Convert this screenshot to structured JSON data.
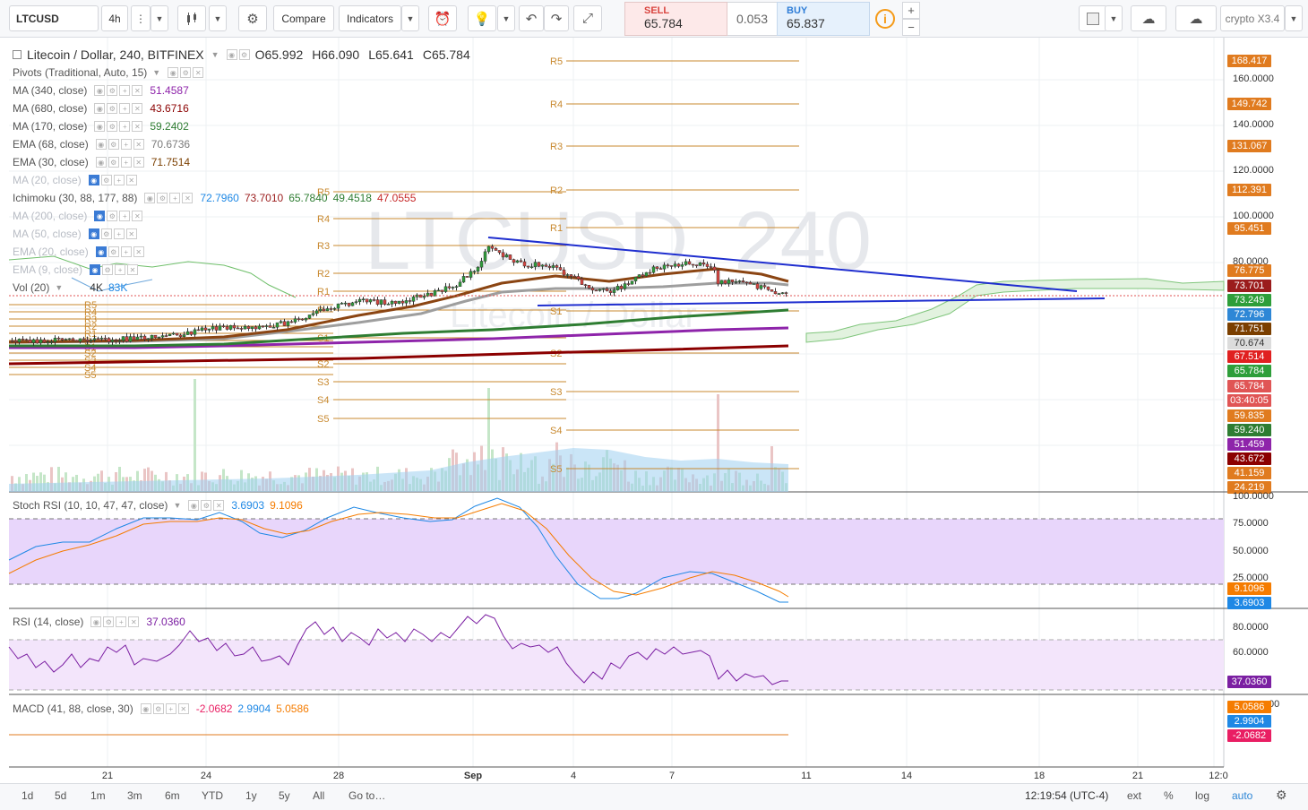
{
  "toolbar": {
    "symbol": "LTCUSD",
    "interval": "4h",
    "compare_label": "Compare",
    "indicators_label": "Indicators",
    "sell_label": "SELL",
    "sell_price": "65.784",
    "spread": "0.053",
    "buy_label": "BUY",
    "buy_price": "65.837",
    "layout_name": "crypto X3.4",
    "icons": [
      "bars-dropdown-icon",
      "candles-icon",
      "gear-icon",
      "alert-icon",
      "lightbulb-icon",
      "undo-icon",
      "redo-icon",
      "fullscreen-icon",
      "info-icon",
      "rectangle-icon",
      "cloud-icon",
      "cloud-upload-icon"
    ]
  },
  "legend": {
    "main": {
      "title": "Litecoin / Dollar, 240, BITFINEX",
      "o": "O65.992",
      "h": "H66.090",
      "l": "L65.641",
      "c": "C65.784"
    },
    "pivots": "Pivots (Traditional, Auto, 15)",
    "ma340": {
      "name": "MA (340, close)",
      "value": "51.4587",
      "color": "#8e24aa"
    },
    "ma680": {
      "name": "MA (680, close)",
      "value": "43.6716",
      "color": "#8b0000"
    },
    "ma170": {
      "name": "MA (170, close)",
      "value": "59.2402",
      "color": "#2e7d32"
    },
    "ema68": {
      "name": "EMA (68, close)",
      "value": "70.6736",
      "color": "#9e9e9e"
    },
    "ema30": {
      "name": "EMA (30, close)",
      "value": "71.7514",
      "color": "#7b3f00"
    },
    "ma20": "MA (20, close)",
    "ichimoku": {
      "name": "Ichimoku (30, 88, 177, 88)",
      "v1": "72.7960",
      "v2": "73.7010",
      "v3": "65.7840",
      "v4": "49.4518",
      "v5": "47.0555"
    },
    "ma200": "MA (200, close)",
    "ma50": "MA (50, close)",
    "ema20": "EMA (20, close)",
    "ema9": "EMA (9, close)",
    "vol": {
      "name": "Vol (20)",
      "v1": "4K",
      "v2": "83K"
    },
    "stoch": {
      "name": "Stoch RSI (10, 10, 47, 47, close)",
      "k": "3.6903",
      "d": "9.1096"
    },
    "rsi": {
      "name": "RSI (14, close)",
      "value": "37.0360"
    },
    "macd": {
      "name": "MACD (41, 88, close, 30)",
      "v1": "-2.0682",
      "v2": "2.9904",
      "v3": "5.0586"
    }
  },
  "watermark": {
    "symbol": "LTCUSD, 240",
    "name": "Litecoin / Dollar"
  },
  "price_scale": {
    "ticks": [
      "160.0000",
      "140.0000",
      "120.0000",
      "100.0000",
      "80.0000"
    ],
    "labels": [
      {
        "text": "168.417",
        "color": "#e07b1f"
      },
      {
        "text": "149.742",
        "color": "#e07b1f"
      },
      {
        "text": "131.067",
        "color": "#e07b1f"
      },
      {
        "text": "112.391",
        "color": "#e07b1f"
      },
      {
        "text": "95.451",
        "color": "#e07b1f"
      },
      {
        "text": "76.775",
        "color": "#e07b1f"
      },
      {
        "text": "73.701",
        "color": "#9b1c1c"
      },
      {
        "text": "73.249",
        "color": "#2e9e3a"
      },
      {
        "text": "72.796",
        "color": "#2e87d6"
      },
      {
        "text": "71.751",
        "color": "#7b3f00"
      },
      {
        "text": "70.674",
        "color": "#9e9e9e"
      },
      {
        "text": "67.514",
        "color": "#e02020"
      },
      {
        "text": "65.784",
        "color": "#2e9e3a"
      },
      {
        "text": "65.784",
        "color": "#e05555"
      },
      {
        "text": "03:40:05",
        "color": "#e05555"
      },
      {
        "text": "59.835",
        "color": "#e07b1f"
      },
      {
        "text": "59.240",
        "color": "#2e7d32"
      },
      {
        "text": "51.459",
        "color": "#8e24aa"
      },
      {
        "text": "43.672",
        "color": "#8b0000"
      },
      {
        "text": "41.159",
        "color": "#e07b1f"
      },
      {
        "text": "24.219",
        "color": "#e07b1f"
      }
    ],
    "stoch_ticks": [
      "100.0000",
      "75.0000",
      "50.0000",
      "25.0000"
    ],
    "stoch_labels": [
      {
        "text": "9.1096",
        "color": "#f57c00"
      },
      {
        "text": "3.6903",
        "color": "#1e88e5"
      }
    ],
    "rsi_ticks": [
      "80.0000",
      "60.0000"
    ],
    "rsi_label": {
      "text": "37.0360",
      "color": "#7b1fa2"
    },
    "macd_tick": "00",
    "macd_labels": [
      {
        "text": "5.0586",
        "color": "#f57c00"
      },
      {
        "text": "2.9904",
        "color": "#1e88e5"
      },
      {
        "text": "-2.0682",
        "color": "#e91e63"
      }
    ]
  },
  "pivot_labels": {
    "right": [
      "R5",
      "R4",
      "R3",
      "R2",
      "R1",
      "S1",
      "S2",
      "S3",
      "S4",
      "S5"
    ],
    "mid": [
      "R5",
      "R4",
      "R3",
      "R2",
      "R1",
      "P",
      "S1",
      "S2",
      "S3",
      "S4",
      "S5"
    ],
    "left": [
      "R5",
      "R4",
      "R3",
      "R2",
      "R1",
      "P",
      "S1",
      "S2",
      "S3",
      "S4",
      "S5"
    ]
  },
  "x_axis": [
    "21",
    "24",
    "28",
    "Sep",
    "4",
    "7",
    "11",
    "14",
    "18",
    "21",
    "12:0"
  ],
  "bottom": {
    "ranges": [
      "1d",
      "5d",
      "1m",
      "3m",
      "6m",
      "YTD",
      "1y",
      "5y",
      "All"
    ],
    "goto": "Go to…",
    "time": "12:19:54 (UTC-4)",
    "ext": "ext",
    "percent": "%",
    "log": "log",
    "auto": "auto"
  }
}
